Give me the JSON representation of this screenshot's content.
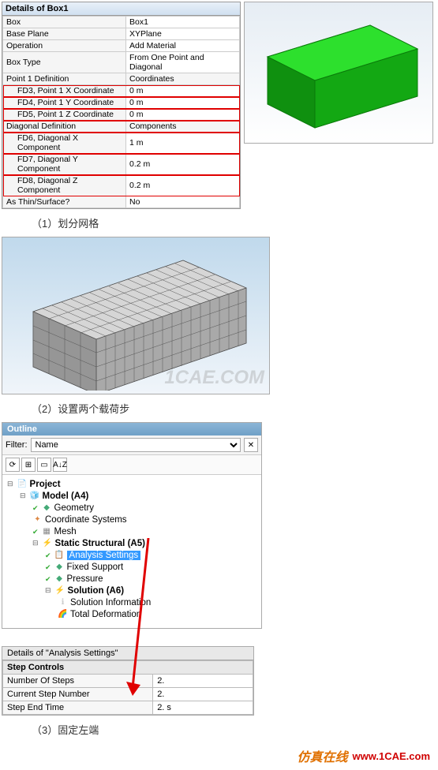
{
  "details_box1": {
    "title": "Details of Box1",
    "rows": [
      {
        "k": "Box",
        "v": "Box1",
        "grp": 0
      },
      {
        "k": "Base Plane",
        "v": "XYPlane",
        "grp": 0
      },
      {
        "k": "Operation",
        "v": "Add Material",
        "grp": 0
      },
      {
        "k": "Box Type",
        "v": "From One Point and Diagonal",
        "grp": 0
      },
      {
        "k": "Point 1 Definition",
        "v": "Coordinates",
        "grp": 1
      },
      {
        "k": "FD3, Point 1 X Coordinate",
        "v": "0 m",
        "grp": 2,
        "indent": 1
      },
      {
        "k": "FD4, Point 1 Y Coordinate",
        "v": "0 m",
        "grp": 2,
        "indent": 1
      },
      {
        "k": "FD5, Point 1 Z Coordinate",
        "v": "0 m",
        "grp": 2,
        "indent": 1
      },
      {
        "k": "Diagonal Definition",
        "v": "Components",
        "grp": 3
      },
      {
        "k": "FD6, Diagonal X Component",
        "v": "1 m",
        "grp": 2,
        "indent": 1
      },
      {
        "k": "FD7, Diagonal Y Component",
        "v": "0.2 m",
        "grp": 2,
        "indent": 1
      },
      {
        "k": "FD8, Diagonal Z Component",
        "v": "0.2 m",
        "grp": 2,
        "indent": 1
      },
      {
        "k": "As Thin/Surface?",
        "v": "No",
        "grp": 0
      }
    ]
  },
  "captions": {
    "c1": "（1）划分网格",
    "c2": "（2）设置两个载荷步",
    "c3": "（3）固定左端"
  },
  "watermark": "1CAE.COM",
  "outline": {
    "title": "Outline",
    "filter_label": "Filter:",
    "filter_value": "Name",
    "sort_btn": "A↓Z",
    "project_label": "Project",
    "model_label": "Model (A4)",
    "items": [
      {
        "label": "Geometry",
        "icon": "ti-geom",
        "chk": 1
      },
      {
        "label": "Coordinate Systems",
        "icon": "ti-coord"
      },
      {
        "label": "Mesh",
        "icon": "ti-mesh",
        "chk": 1
      }
    ],
    "structural_label": "Static Structural (A5)",
    "structural_items": [
      {
        "label": "Analysis Settings",
        "icon": "ti-set",
        "selected": 1
      },
      {
        "label": "Fixed Support",
        "icon": "ti-fix",
        "chk": 1
      },
      {
        "label": "Pressure",
        "icon": "ti-press",
        "chk": 1
      }
    ],
    "solution_label": "Solution (A6)",
    "solution_items": [
      {
        "label": "Solution Information",
        "icon": "ti-info"
      },
      {
        "label": "Total Deformation",
        "icon": "ti-def"
      }
    ]
  },
  "details2": {
    "title": "Details of \"Analysis Settings\"",
    "section": "Step Controls",
    "rows": [
      {
        "k": "Number Of Steps",
        "v": "2."
      },
      {
        "k": "Current Step Number",
        "v": "2."
      },
      {
        "k": "Step End Time",
        "v": "2. s"
      }
    ]
  },
  "footer": {
    "brand1": "仿真在线",
    "brand2": "www.1CAE.com"
  }
}
